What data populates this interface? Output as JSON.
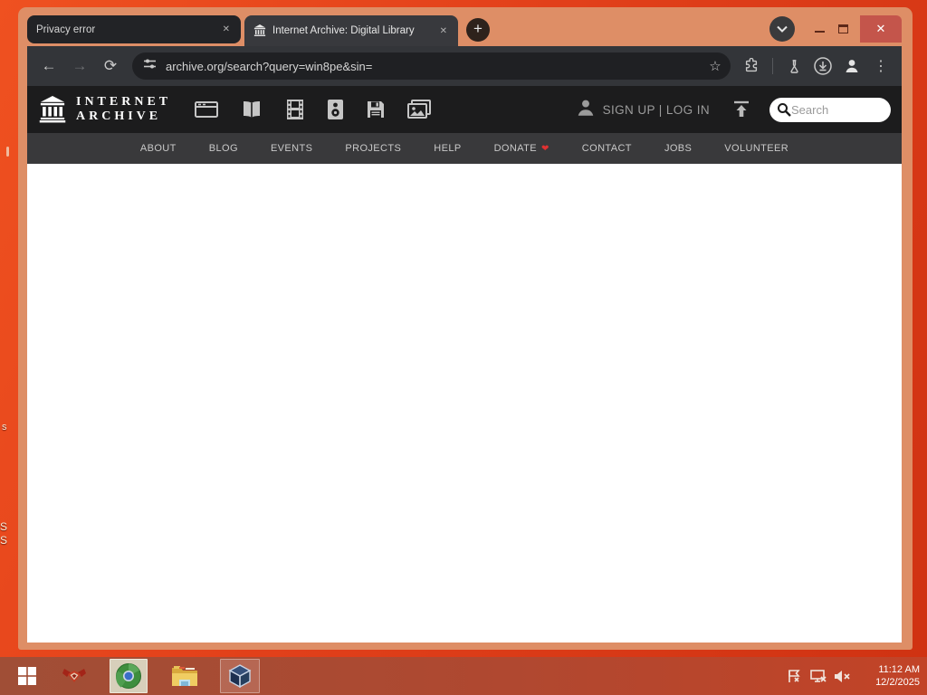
{
  "browser": {
    "tabs": [
      {
        "title": "Privacy error"
      },
      {
        "title": "Internet Archive: Digital Library"
      }
    ],
    "url": "archive.org/search?query=win8pe&sin="
  },
  "ia": {
    "wordmark": [
      "INTERNET",
      "ARCHIVE"
    ],
    "account": "SIGN UP | LOG IN",
    "search_placeholder": "Search",
    "nav": [
      "ABOUT",
      "BLOG",
      "EVENTS",
      "PROJECTS",
      "HELP",
      "DONATE",
      "CONTACT",
      "JOBS",
      "VOLUNTEER"
    ]
  },
  "taskbar": {
    "time": "11:12 AM",
    "date": "12/2/2025"
  },
  "desktop_fragments": [
    "s",
    "S",
    "S"
  ],
  "glyphs": {
    "back": "←",
    "forward": "→",
    "reload": "⟳",
    "star": "☆",
    "menu": "⋮",
    "tab_close": "✕",
    "new_tab": "+",
    "window_close": "✕",
    "heart": "❤"
  },
  "colors": {
    "desktop": "#e0421a",
    "window_frame": "#de8e66",
    "ia_header": "#1c1c1d",
    "ia_nav": "#39393b",
    "donate_heart": "#e03131",
    "close_button": "#c4554b"
  }
}
